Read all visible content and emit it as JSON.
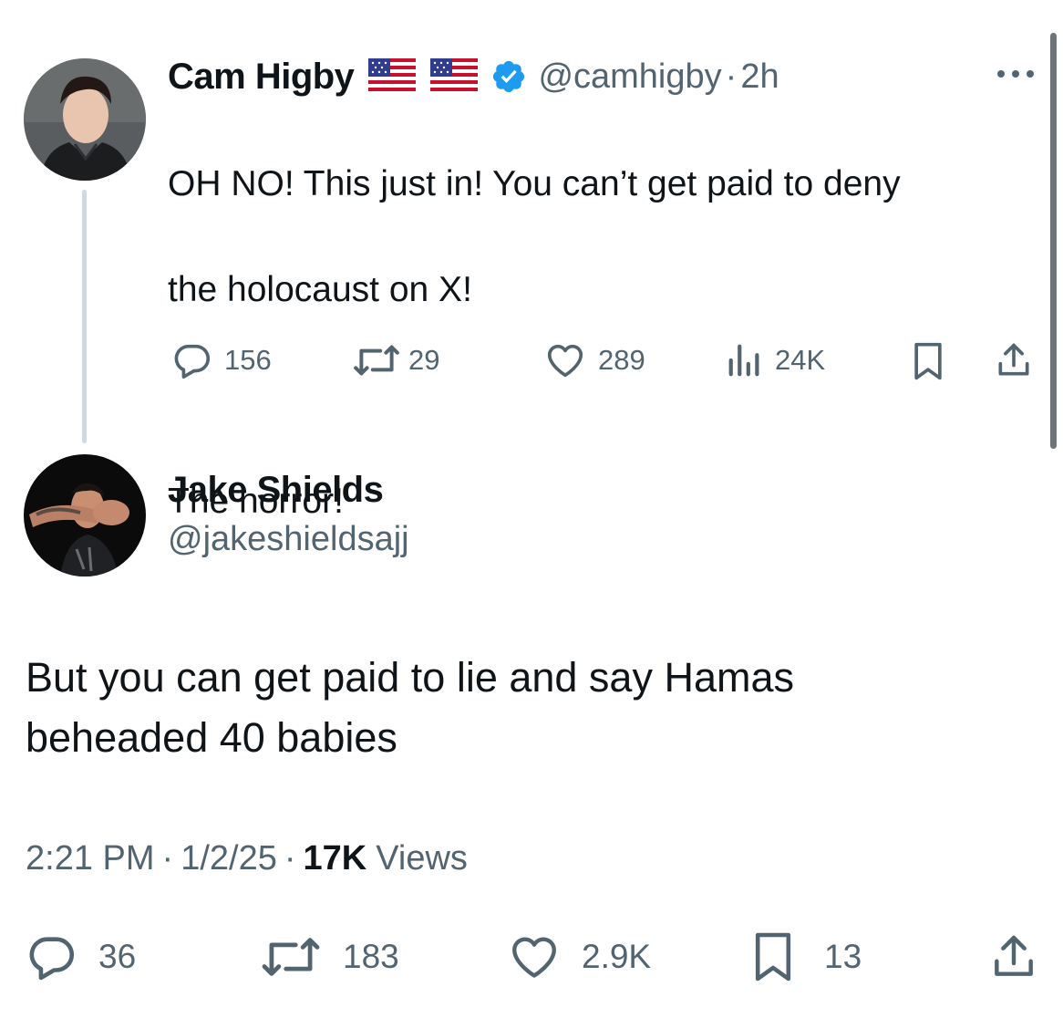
{
  "quoted_tweet": {
    "author_name": "Cam Higby",
    "author_flags": [
      "us-flag-icon",
      "us-flag-icon"
    ],
    "verified": true,
    "handle": "@camhigby",
    "separator": "·",
    "time": "2h",
    "text_line1": "OH NO! This just in! You can’t get paid to deny",
    "text_line2": "the holocaust on X!",
    "text_line3": "The horror!",
    "stats": {
      "replies": "156",
      "reposts": "29",
      "likes": "289",
      "views": "24K"
    }
  },
  "main_tweet": {
    "author_name": "Jake Shields",
    "handle": "@jakeshieldsajj",
    "text_line1": "But you can get paid to lie and say Hamas",
    "text_line2": "beheaded 40 babies",
    "timestamp": "2:21 PM",
    "date": "1/2/25",
    "dot": "·",
    "views_count": "17K",
    "views_label": "Views",
    "stats": {
      "replies": "36",
      "reposts": "183",
      "likes": "2.9K",
      "bookmarks": "13"
    }
  },
  "colors": {
    "text": "#0f1419",
    "secondary": "#536471",
    "verified": "#1d9bf0",
    "thread_line": "#cfd9de"
  }
}
